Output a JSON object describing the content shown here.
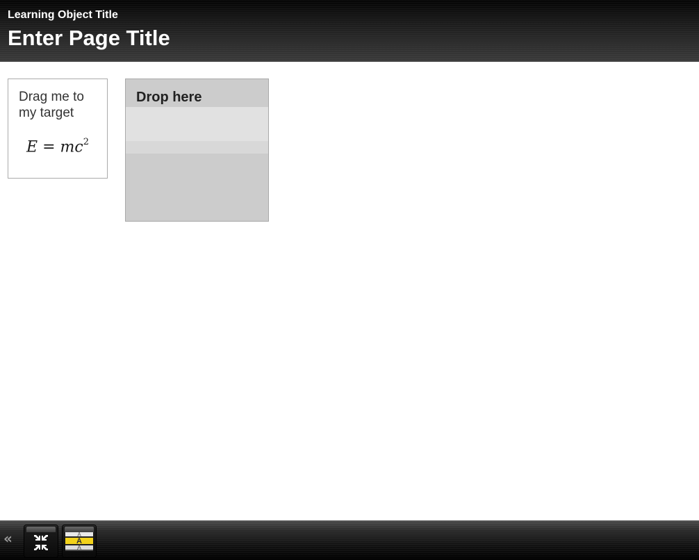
{
  "header": {
    "learning_object_title": "Learning Object Title",
    "page_title": "Enter Page Title"
  },
  "drag_item": {
    "text": "Drag me to my target",
    "equation": {
      "lhs": "E",
      "operator": "=",
      "rhs_var1": "m",
      "rhs_var2": "c",
      "exponent": "2"
    }
  },
  "drop_target": {
    "label": "Drop here"
  },
  "toolbar": {
    "collapse_icon": "double-chevron-left-icon",
    "buttons": [
      {
        "name": "exit-fullscreen-button",
        "icon": "compress-arrows-icon"
      },
      {
        "name": "text-size-button",
        "icon": "text-size-icon",
        "glyph": "A",
        "accent_color": "#f2d21b"
      }
    ]
  },
  "colors": {
    "header_bg_top": "#050505",
    "header_bg_bottom": "#3a3a3a",
    "drop_target_bg": "#cccccc",
    "drop_slot_bg": "#e1e1e1",
    "text_size_highlight": "#f2d21b"
  }
}
